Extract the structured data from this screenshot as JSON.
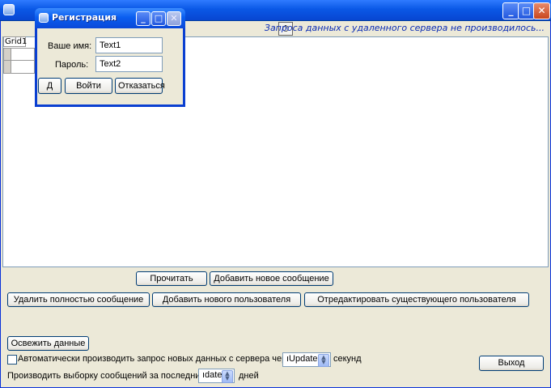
{
  "main_window": {
    "status_text": "Запроса данных с удаленного сервера не производилось...",
    "grid_caption": "Grid1"
  },
  "buttons": {
    "read": "Прочитать",
    "add_message": "Добавить новое сообщение",
    "delete_message": "Удалить полностью сообщение",
    "add_user": "Добавить нового пользователя",
    "edit_user": "Отредактировать существующего пользователя",
    "refresh": "Освежить данные",
    "exit": "Выход"
  },
  "auto_request": {
    "label": "Автоматически производить запрос новых данных с сервера через",
    "spin_value": "ıUpdate",
    "unit": "секунд",
    "checked": false
  },
  "selection": {
    "label": "Производить выборку сообщений за последние",
    "spin_value": "ıdate",
    "unit": "дней"
  },
  "dialog": {
    "title": "Регистрация",
    "name_label": "Ваше имя:",
    "name_value": "Text1",
    "password_label": "Пароль:",
    "password_value": "Text2",
    "d_button": "Д",
    "login_button": "Войти",
    "cancel_button": "Отказаться"
  },
  "icons": {
    "minimize": "minimize-icon",
    "maximize": "maximize-icon",
    "close": "close-icon",
    "timer": "timer-icon"
  },
  "colors": {
    "titlebar": "#0a58e6",
    "status_text": "#0a2bb3",
    "face": "#ece9d8"
  }
}
